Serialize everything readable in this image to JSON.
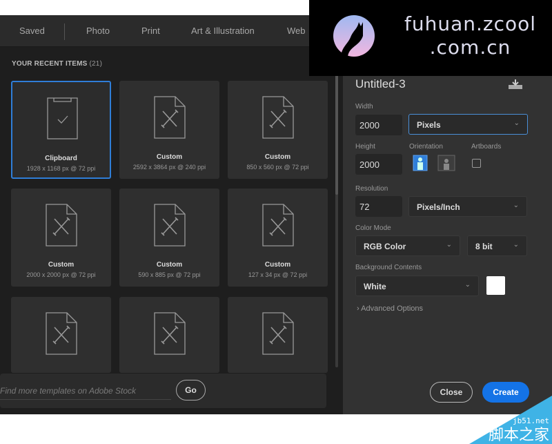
{
  "tabs": [
    "Saved",
    "Photo",
    "Print",
    "Art & Illustration",
    "Web"
  ],
  "recent": {
    "title": "YOUR RECENT ITEMS",
    "count": "(21)",
    "items": [
      {
        "name": "Clipboard",
        "dims": "1928 x 1168 px @ 72 ppi",
        "icon": "clipboard-icon",
        "selected": true
      },
      {
        "name": "Custom",
        "dims": "2592 x 3864 px @ 240 ppi",
        "icon": "document-icon"
      },
      {
        "name": "Custom",
        "dims": "850 x 560 px @ 72 ppi",
        "icon": "document-icon"
      },
      {
        "name": "Custom",
        "dims": "2000 x 2000 px @ 72 ppi",
        "icon": "document-icon"
      },
      {
        "name": "Custom",
        "dims": "590 x 885 px @ 72 ppi",
        "icon": "document-icon"
      },
      {
        "name": "Custom",
        "dims": "127 x 34 px @ 72 ppi",
        "icon": "document-icon"
      },
      {
        "icon": "document-icon"
      },
      {
        "icon": "document-icon"
      },
      {
        "icon": "document-icon"
      }
    ]
  },
  "search": {
    "placeholder": "Find more templates on Adobe Stock",
    "go": "Go"
  },
  "details": {
    "name": "Untitled-3",
    "width_label": "Width",
    "width": "2000",
    "unit": "Pixels",
    "height_label": "Height",
    "height": "2000",
    "orientation_label": "Orientation",
    "artboards_label": "Artboards",
    "resolution_label": "Resolution",
    "resolution": "72",
    "res_unit": "Pixels/Inch",
    "color_mode_label": "Color Mode",
    "color_mode": "RGB Color",
    "bit_depth": "8 bit",
    "bg_label": "Background Contents",
    "bg": "White",
    "bg_color": "#ffffff",
    "advanced": "Advanced Options",
    "close": "Close",
    "create": "Create"
  },
  "colors": {
    "accent": "#1473e6",
    "selected_border": "#2f7ed8"
  },
  "watermarks": {
    "zcool": "fuhuan.zcool .com.cn",
    "jb51_url": "jb51.net",
    "jb51_name": "脚本之家"
  }
}
